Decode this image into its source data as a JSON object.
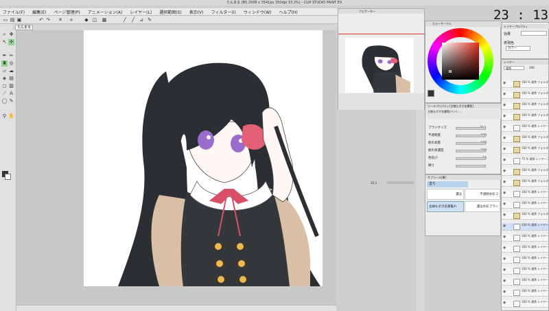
{
  "window": {
    "title": "らんまる (B5 2508 x 3541px 350dpi 33.3%) - CLIP STUDIO PAINT EX"
  },
  "menu": [
    "ファイル(F)",
    "編集(E)",
    "ページ管理(P)",
    "アニメーション(A)",
    "レイヤー(L)",
    "選択範囲(S)",
    "表示(V)",
    "フィルター(I)",
    "ウィンドウ(W)",
    "ヘルプ(H)"
  ],
  "clock": "23 : 13",
  "navigator": {
    "title": "ナビゲーター",
    "zoom": "33.3"
  },
  "color_panel": {
    "title": "カラーサークル",
    "wheel_hue": 8
  },
  "tool_property": {
    "title": "ツールプロパティ[主線もポポ名暴覧]",
    "brush_name": "主線もポポ名暴覧(ペン) - ...",
    "rows": [
      {
        "label": "ブラシサイズ",
        "value": "30.1"
      },
      {
        "label": "不透明度",
        "value": "100"
      },
      {
        "label": "絵の具量",
        "value": "100"
      },
      {
        "label": "絵の具濃度",
        "value": "100"
      },
      {
        "label": "色延び",
        "value": "84"
      },
      {
        "label": "硬さ",
        "value": ""
      }
    ]
  },
  "sub_tool": {
    "title": "サブツール[筆]",
    "group": "塗り",
    "items": [
      "濃淡",
      "不透明水彩 2",
      "主線もポポ名暴覧れ",
      "濃淡水彩ブラシ"
    ]
  },
  "layer_property": {
    "title": "レイヤープロパティ",
    "effect_label": "効果",
    "blend_label": "表現色",
    "blend_value": "カラー"
  },
  "layers_panel": {
    "title": "レイヤー",
    "blend": "通常",
    "opacity": "100",
    "layers": [
      {
        "name": "100 % 通常 フォルダー 5",
        "folder": true
      },
      {
        "name": "100 % 通常 フォルダー 11",
        "folder": true
      },
      {
        "name": "100 % 通常 フォルダー 12",
        "folder": true
      },
      {
        "name": "100 % 通常 フォルダー 13",
        "folder": true
      },
      {
        "name": "100 % 通常 レイヤー 290",
        "folder": false
      },
      {
        "name": "100 % 通常 フォルダー 14",
        "folder": true
      },
      {
        "name": "100 % 通常 フォルダー 15",
        "folder": true
      },
      {
        "name": "75 % 通常 レイヤー 291",
        "folder": false
      },
      {
        "name": "100 % 通常 フォルダー 25",
        "folder": true
      },
      {
        "name": "100 % 通常 フォルダー 1",
        "folder": true
      },
      {
        "name": "100 % 通常 レイヤー",
        "folder": false
      },
      {
        "name": "100 % 通常 レイヤー",
        "folder": false
      },
      {
        "name": "100 % 通常 フォルダー 26",
        "folder": true
      },
      {
        "name": "100 % 通常 レイヤー",
        "folder": false,
        "selected": true
      },
      {
        "name": "100 % 通常 レイヤー",
        "folder": false
      },
      {
        "name": "100 % 通常 レイヤー",
        "folder": false
      },
      {
        "name": "100 % 通常 レイヤー",
        "folder": false
      },
      {
        "name": "100 % 通常 レイヤー",
        "folder": false
      },
      {
        "name": "100 % 通常 レイヤー",
        "folder": false
      },
      {
        "name": "100 % 通常 レイヤー",
        "folder": false
      },
      {
        "name": "100 % 通常 レイヤー",
        "folder": false
      }
    ]
  },
  "document_tab": "らんまる",
  "colors": {
    "hair": "#2b2e33",
    "cardigan": "#d9bfa6",
    "dress": "#34383b",
    "ribbon": "#d94f68",
    "eyes": "#9a6ccc",
    "buttons": "#f0b84a",
    "earmuff": "#e36077"
  }
}
